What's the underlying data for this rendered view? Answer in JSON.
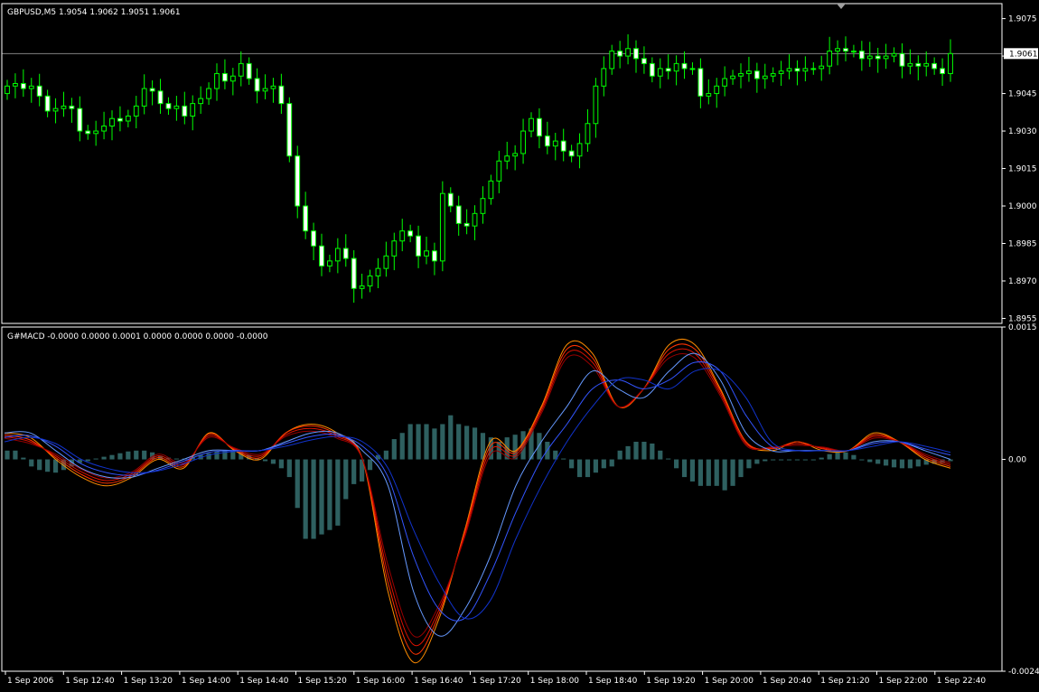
{
  "colors": {
    "background": "#000000",
    "frame": "#ffffff",
    "bull_candle_body": "#000000",
    "bear_candle_body": "#ffffff",
    "wick": "#00ff00",
    "text": "#ffffff",
    "bid_line": "#808080",
    "histogram": "#2e6060",
    "macd_lines": [
      "#ff8c00",
      "#ff3300",
      "#dd1100",
      "#990000"
    ],
    "signal_lines": [
      "#6699ff",
      "#3355ff",
      "#1133cc"
    ]
  },
  "main_panel": {
    "header": "GBPUSD,M5  1.9054 1.9062 1.9051 1.9061",
    "price_scale": [
      "1.9075",
      "1.9060",
      "1.9045",
      "1.9030",
      "1.9015",
      "1.9000",
      "1.8985",
      "1.8970",
      "1.8955"
    ],
    "current_price": "1.9061",
    "marker_icon": "triangle-down-icon"
  },
  "indicator_panel": {
    "header": "G#MACD -0.0000 0.0000 0.0001 0.0000 0.0000 0.0000 -0.0000",
    "scale": [
      "0.0015",
      "0.00",
      "-0.0024"
    ]
  },
  "time_axis": [
    "1 Sep 2006",
    "1 Sep 12:40",
    "1 Sep 13:20",
    "1 Sep 14:00",
    "1 Sep 14:40",
    "1 Sep 15:20",
    "1 Sep 16:00",
    "1 Sep 16:40",
    "1 Sep 17:20",
    "1 Sep 18:00",
    "1 Sep 18:40",
    "1 Sep 19:20",
    "1 Sep 20:00",
    "1 Sep 20:40",
    "1 Sep 21:20",
    "1 Sep 22:00",
    "1 Sep 22:40"
  ],
  "chart_data": [
    {
      "type": "candlestick",
      "title": "GBPUSD,M5  1.9054 1.9062 1.9051 1.9061",
      "timeframe_minutes": 5,
      "ylim": [
        1.8953,
        1.9081
      ],
      "series": [
        {
          "name": "GBPUSD",
          "closes": [
            1.9048,
            1.9049,
            1.9047,
            1.9048,
            1.9044,
            1.9038,
            1.9039,
            1.904,
            1.9039,
            1.903,
            1.9029,
            1.903,
            1.9032,
            1.9035,
            1.9034,
            1.9036,
            1.904,
            1.9047,
            1.9046,
            1.9041,
            1.9039,
            1.904,
            1.9036,
            1.9041,
            1.9043,
            1.9047,
            1.9053,
            1.905,
            1.9052,
            1.9057,
            1.9051,
            1.9046,
            1.9047,
            1.9048,
            1.9041,
            1.902,
            1.9,
            1.899,
            1.8984,
            1.8976,
            1.8978,
            1.8983,
            1.8979,
            1.8967,
            1.8968,
            1.8972,
            1.8975,
            1.898,
            1.8986,
            1.899,
            1.8988,
            1.898,
            1.8982,
            1.8978,
            1.9005,
            1.9,
            1.8993,
            1.8992,
            1.8997,
            1.9003,
            1.901,
            1.9018,
            1.902,
            1.9021,
            1.903,
            1.9035,
            1.9028,
            1.9024,
            1.9026,
            1.9022,
            1.902,
            1.9025,
            1.9033,
            1.9048,
            1.9055,
            1.9062,
            1.906,
            1.9063,
            1.9059,
            1.9057,
            1.9052,
            1.9055,
            1.9054,
            1.9057,
            1.9055,
            1.9055,
            1.9044,
            1.9045,
            1.9048,
            1.9051,
            1.9052,
            1.9053,
            1.9054,
            1.9051,
            1.9052,
            1.9053,
            1.9054,
            1.9055,
            1.9054,
            1.9055,
            1.9055,
            1.9056,
            1.9062,
            1.9063,
            1.9062,
            1.9062,
            1.9059,
            1.906,
            1.9059,
            1.906,
            1.9061,
            1.9056,
            1.9057,
            1.9056,
            1.9057,
            1.9055,
            1.9053,
            1.9061
          ]
        }
      ]
    },
    {
      "type": "line",
      "title": "G#MACD -0.0000 0.0000 0.0001 0.0000 0.0000 0.0000 -0.0000",
      "ylim": [
        -0.0024,
        0.0015
      ],
      "series": [
        {
          "name": "G#MACD",
          "style": "histogram",
          "values": [
            0.0001,
            0.0001,
            2e-05,
            -8e-05,
            -0.00012,
            -0.00014,
            -0.00015,
            -0.00012,
            -8e-05,
            -4e-05,
            -2e-05,
            1e-05,
            3e-05,
            5e-05,
            7e-05,
            9e-05,
            0.0001,
            0.0001,
            8e-05,
            4e-05,
            2e-05,
            1e-05,
            1e-05,
            3e-05,
            5e-05,
            7e-05,
            9e-05,
            0.0001,
            0.0001,
            9e-05,
            5e-05,
            1e-05,
            -2e-05,
            -5e-05,
            -0.0001,
            -0.0002,
            -0.00055,
            -0.0009,
            -0.0009,
            -0.00085,
            -0.0008,
            -0.00075,
            -0.00045,
            -0.00028,
            -0.00025,
            -0.00012,
            5e-05,
            0.0001,
            0.00023,
            0.0003,
            0.0004,
            0.0004,
            0.0004,
            0.00035,
            0.0004,
            0.0005,
            0.0004,
            0.00038,
            0.00036,
            0.0003,
            0.00025,
            0.0002,
            0.00025,
            0.00028,
            0.00032,
            0.00035,
            0.0003,
            0.0002,
            0.0001,
            1e-05,
            -0.0001,
            -0.0002,
            -0.0002,
            -0.00015,
            -0.0001,
            -8e-05,
            0.0001,
            0.00015,
            0.0002,
            0.0002,
            0.00018,
            0.0001,
            1e-05,
            -0.0001,
            -0.0002,
            -0.00025,
            -0.0003,
            -0.0003,
            -0.0003,
            -0.00035,
            -0.0003,
            -0.0002,
            -0.0001,
            -5e-05,
            -2e-05,
            0.0,
            0.0,
            -1e-05,
            0.0,
            -1e-05,
            0.0,
            2e-05,
            6e-05,
            0.0001,
            8e-05,
            5e-05,
            0.0,
            -3e-05,
            -5e-05,
            -7e-05,
            -9e-05,
            -0.0001,
            -0.0001,
            -8e-05,
            -6e-05,
            -5e-05,
            -4e-05,
            -2e-05
          ]
        },
        {
          "name": "macd-fast-1",
          "values": [
            0.0003,
            0.00025,
            0.0,
            -0.0002,
            -0.0003,
            -0.0002,
            0.0,
            -0.0001,
            0.0003,
            0.0001,
            0.0,
            0.0003,
            0.0004,
            0.0003,
            0.0,
            -0.0015,
            -0.0023,
            -0.0018,
            -0.0008,
            0.0002,
            0.0001,
            0.0006,
            0.0013,
            0.0012,
            0.0006,
            0.0008,
            0.0013,
            0.0013,
            0.0008,
            0.0002,
            0.0001,
            0.0002,
            0.0001,
            0.0001,
            0.0003,
            0.0002,
            0.0,
            -0.0001
          ]
        },
        {
          "name": "macd-fast-2",
          "values": [
            0.00028,
            0.00022,
            2e-05,
            -0.00017,
            -0.00027,
            -0.00018,
            2e-05,
            -8e-05,
            0.00029,
            0.00011,
            2e-05,
            0.0003,
            0.00038,
            0.00028,
            0.0,
            -0.0014,
            -0.0022,
            -0.00175,
            -0.00082,
            0.00015,
            8e-05,
            0.00058,
            0.00125,
            0.00115,
            0.0006,
            0.0008,
            0.00125,
            0.00125,
            0.00078,
            0.0002,
            0.00012,
            0.0002,
            0.00012,
            0.0001,
            0.00028,
            0.0002,
            2e-05,
            -8e-05
          ]
        },
        {
          "name": "macd-fast-3",
          "values": [
            0.00026,
            0.0002,
            4e-05,
            -0.00014,
            -0.00024,
            -0.00016,
            4e-05,
            -6e-05,
            0.00027,
            0.00012,
            4e-05,
            0.00028,
            0.00035,
            0.00026,
            0.0,
            -0.0013,
            -0.0021,
            -0.0017,
            -0.00085,
            0.0001,
            5e-05,
            0.00055,
            0.0012,
            0.0011,
            0.0006,
            0.0008,
            0.0012,
            0.0012,
            0.00075,
            0.00018,
            0.00013,
            0.00018,
            0.00013,
            0.0001,
            0.00026,
            0.0002,
            4e-05,
            -6e-05
          ]
        },
        {
          "name": "macd-fast-4",
          "values": [
            0.00024,
            0.00018,
            6e-05,
            -0.00011,
            -0.00021,
            -0.00014,
            6e-05,
            -4e-05,
            0.00025,
            0.00013,
            6e-05,
            0.00026,
            0.00032,
            0.00024,
            0.0,
            -0.0012,
            -0.002,
            -0.00165,
            -0.00088,
            5e-05,
            2e-05,
            0.00052,
            0.00115,
            0.00105,
            0.0006,
            0.0008,
            0.00115,
            0.00115,
            0.00072,
            0.00016,
            0.00014,
            0.00016,
            0.00014,
            0.0001,
            0.00024,
            0.0002,
            6e-05,
            -4e-05
          ]
        },
        {
          "name": "signal-1",
          "values": [
            0.0003,
            0.0003,
            0.0001,
            -0.0001,
            -0.0002,
            -0.0002,
            -0.0001,
            0.0,
            0.0001,
            0.0001,
            0.0001,
            0.0002,
            0.0003,
            0.0003,
            0.0001,
            -0.0003,
            -0.0015,
            -0.002,
            -0.0017,
            -0.0011,
            -0.0003,
            0.0002,
            0.0006,
            0.001,
            0.0008,
            0.0007,
            0.001,
            0.0012,
            0.0009,
            0.0003,
            0.0001,
            0.0001,
            0.0001,
            0.0001,
            0.0002,
            0.0002,
            0.0001,
            0.0
          ]
        },
        {
          "name": "signal-2",
          "values": [
            0.00025,
            0.00027,
            0.00015,
            -5e-05,
            -0.00015,
            -0.00018,
            -0.00012,
            -2e-05,
            8e-05,
            0.0001,
            0.0001,
            0.00018,
            0.00026,
            0.00028,
            0.00015,
            -0.0002,
            -0.0011,
            -0.0017,
            -0.0018,
            -0.0013,
            -0.0006,
            0.0,
            0.0004,
            0.0008,
            0.0009,
            0.0008,
            0.0009,
            0.0011,
            0.001,
            0.0005,
            0.00015,
            0.0001,
            0.0001,
            0.0001,
            0.00018,
            0.0002,
            0.00012,
            5e-05
          ]
        },
        {
          "name": "signal-3",
          "values": [
            0.0002,
            0.00025,
            0.00018,
            0.0,
            -0.0001,
            -0.00015,
            -0.00013,
            -5e-05,
            5e-05,
            9e-05,
            0.0001,
            0.00015,
            0.00022,
            0.00026,
            0.0002,
            -0.0001,
            -0.0008,
            -0.0014,
            -0.0018,
            -0.0016,
            -0.0009,
            -0.0003,
            0.0002,
            0.0006,
            0.0009,
            0.0009,
            0.0008,
            0.001,
            0.001,
            0.0007,
            0.0002,
            0.0001,
            0.0001,
            0.0001,
            0.00015,
            0.0002,
            0.00015,
            8e-05
          ]
        }
      ]
    }
  ]
}
